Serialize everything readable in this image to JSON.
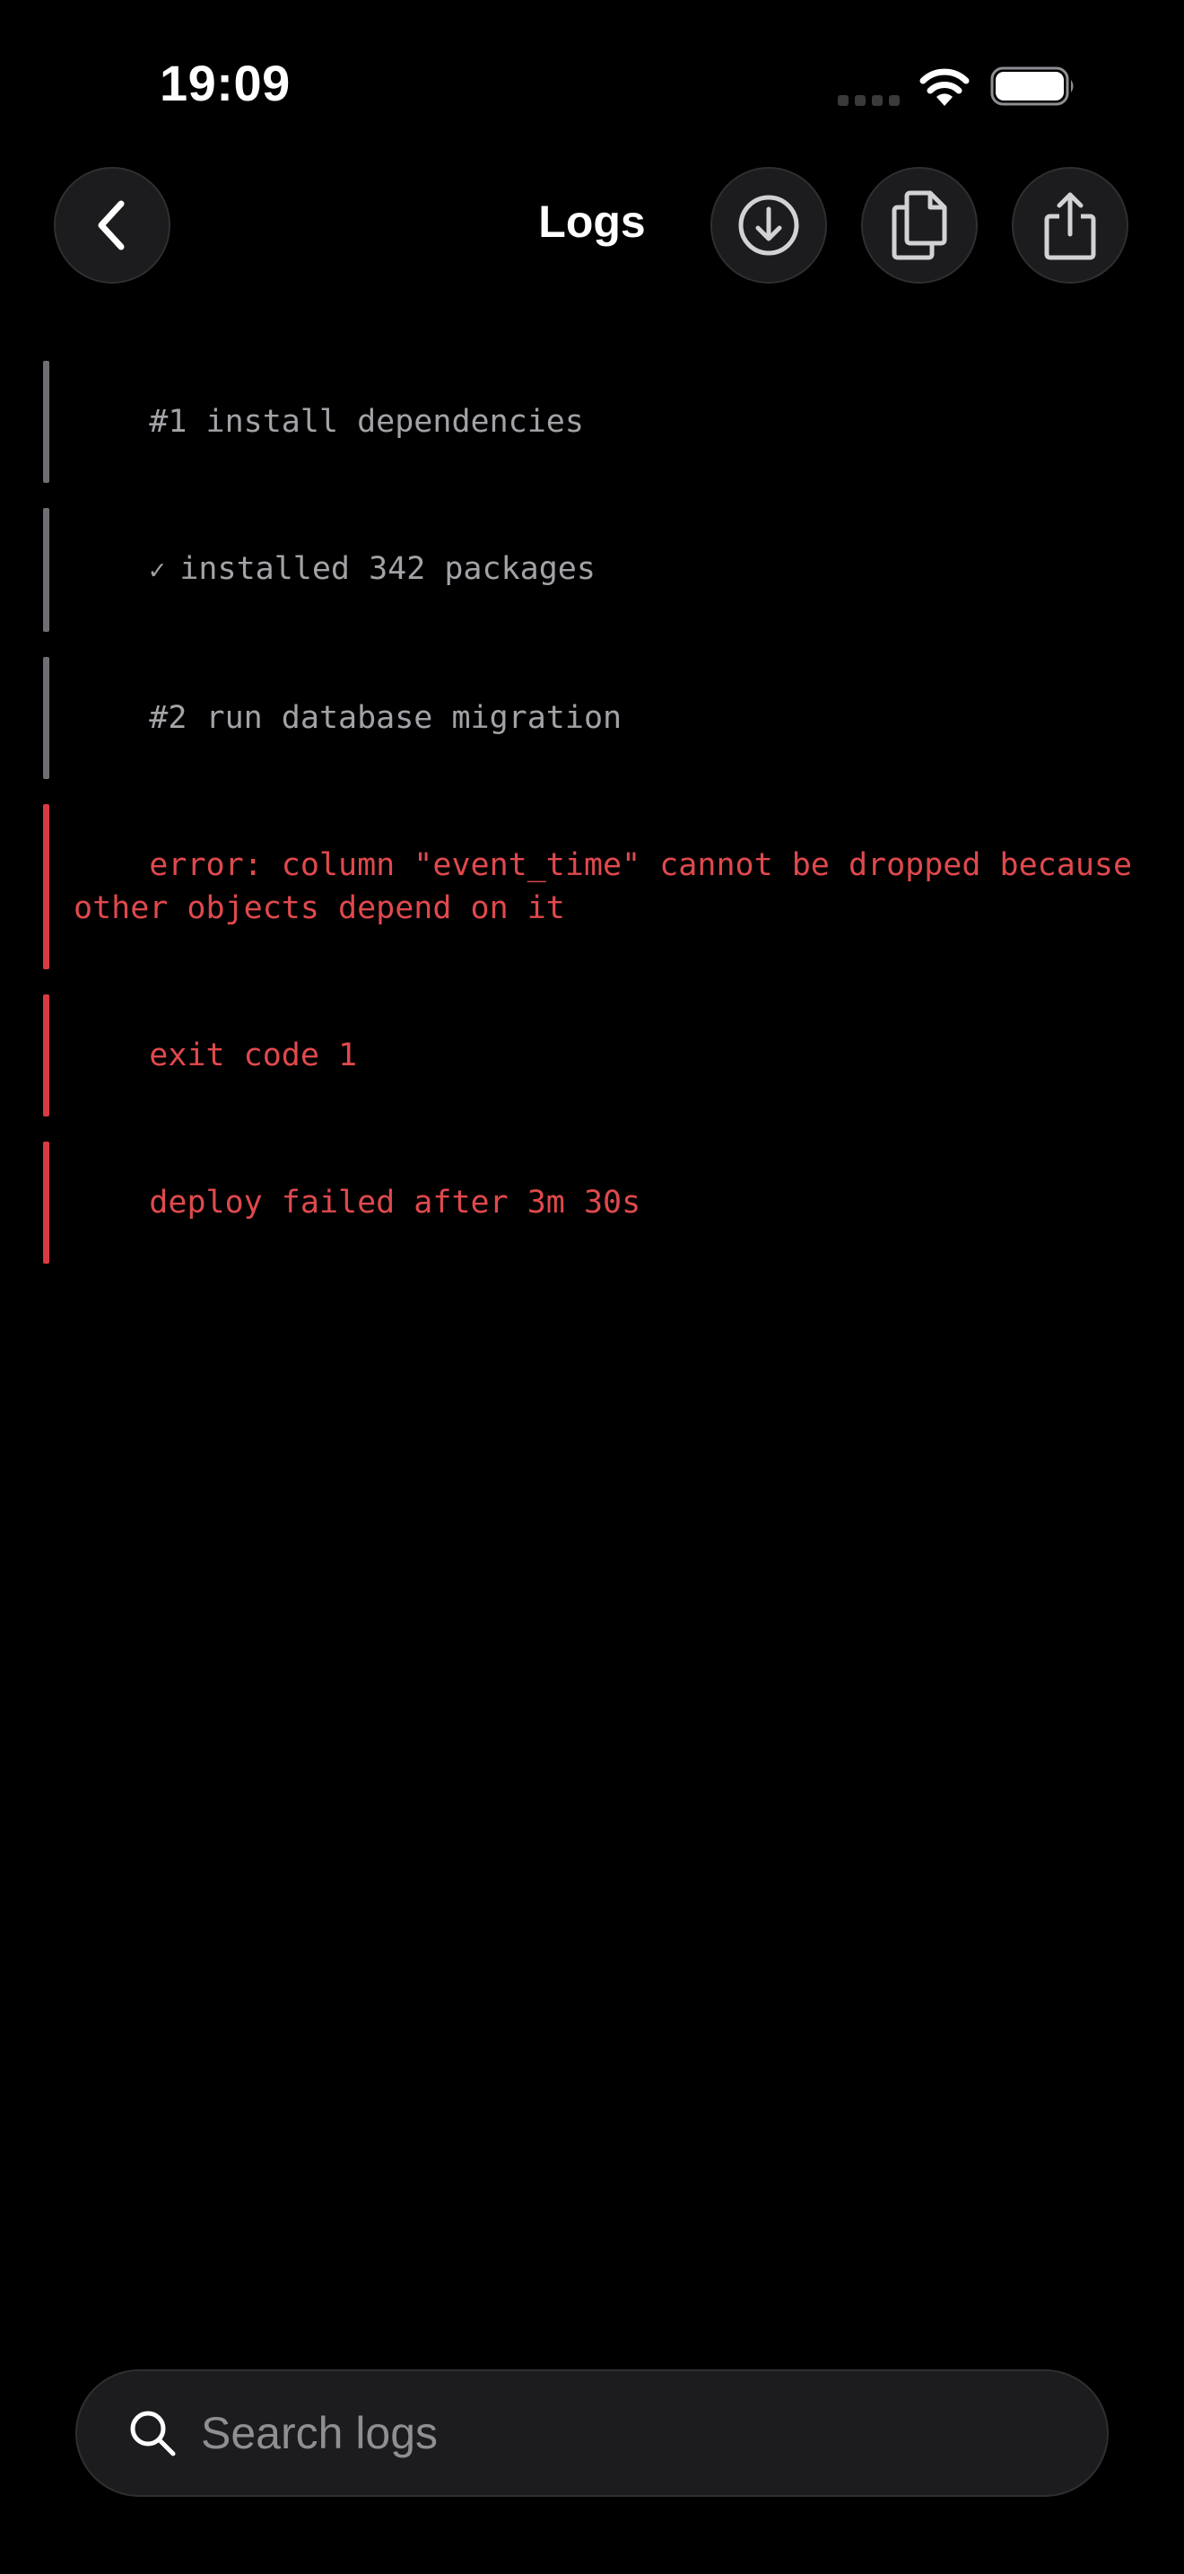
{
  "status_bar": {
    "time": "19:09"
  },
  "nav": {
    "title": "Logs",
    "icons": {
      "back": "chevron-left-icon",
      "download": "download-circle-icon",
      "copy": "copy-documents-icon",
      "share": "share-icon"
    }
  },
  "logs": [
    {
      "level": "info",
      "text": "#1 install dependencies"
    },
    {
      "level": "info",
      "check": "✓",
      "text": "installed 342 packages"
    },
    {
      "level": "info",
      "text": "#2 run database migration"
    },
    {
      "level": "error",
      "text": "error: column \"event_time\" cannot be dropped because other objects depend on it"
    },
    {
      "level": "error",
      "text": "exit code 1"
    },
    {
      "level": "error",
      "text": "deploy failed after 3m 30s"
    }
  ],
  "search": {
    "placeholder": "Search logs",
    "value": ""
  },
  "colors": {
    "background": "#000000",
    "button_fill": "#1c1c1e",
    "info_text": "#a2a2a7",
    "error_text": "#e0494d"
  }
}
